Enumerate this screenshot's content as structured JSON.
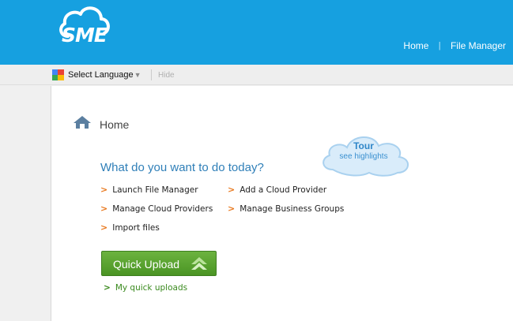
{
  "header": {
    "logo_text": "SME",
    "nav": [
      {
        "label": "Home"
      },
      {
        "label": "File Manager"
      }
    ],
    "separator": "|",
    "background": "#16a0e0"
  },
  "language_bar": {
    "select_label": "Select Language",
    "hide_label": "Hide",
    "icon": "google-translate-icon"
  },
  "main": {
    "page_title": "Home",
    "tour": {
      "title": "Tour",
      "subtitle": "see highlights"
    },
    "question": "What do you want to do today?",
    "actions": [
      {
        "label": "Launch File Manager"
      },
      {
        "label": "Add a Cloud Provider"
      },
      {
        "label": "Manage Cloud Providers"
      },
      {
        "label": "Manage Business Groups"
      },
      {
        "label": "Import files"
      }
    ],
    "quick_upload_label": "Quick Upload",
    "my_uploads_label": "My quick uploads",
    "accent_color": "#2f7fb8",
    "button_color": "#5aa332"
  }
}
